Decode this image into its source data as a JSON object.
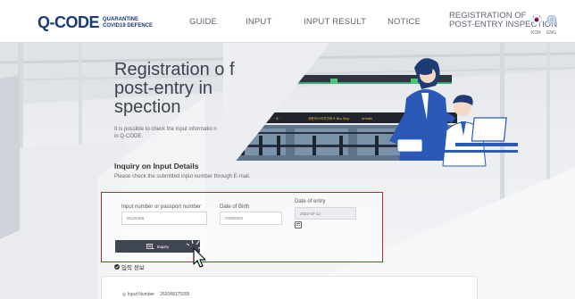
{
  "header": {
    "logo": {
      "main": "Q-CODE",
      "sub_line1": "QUARANTINE",
      "sub_line2": "COVID19 DEFENCE"
    },
    "nav": [
      {
        "label": "GUIDE"
      },
      {
        "label": "INPUT"
      },
      {
        "label": "INPUT RESULT"
      },
      {
        "label": "NOTICE"
      }
    ],
    "registration": {
      "line1": "REGISTRATION OF",
      "line2": "POST-ENTRY INSPECTION"
    },
    "languages": [
      {
        "code": "KOR"
      },
      {
        "code": "ENG"
      }
    ]
  },
  "hero": {
    "title": "Registration o f post-entry in spection",
    "description": "It is possible to check the input informatio n in Q-CODE.",
    "signboard": [
      {
        "text": "현금카드/교통카드 충전(1층) · ·· $ ··"
      },
      {
        "text": "공항버스/리무진버스 Bus Stop"
      },
      {
        "text": "Arrivals"
      }
    ]
  },
  "inquiry": {
    "title": "Inquiry on Input Details",
    "subtitle": "Please check the submitted input number through E-mail.",
    "fields": {
      "input_number": {
        "label": "Input number or passport number",
        "value": "M12S456"
      },
      "birth": {
        "label": "Date of Birth",
        "value": "20060304"
      },
      "entry": {
        "label": "Date of entry",
        "value": "2022-07-12"
      }
    },
    "button_label": "Inquiry"
  },
  "result": {
    "heading": "입력 정보",
    "row_label": "Input Number",
    "row_value": "262048175095"
  },
  "colors": {
    "brand_navy": "#1e3a72",
    "highlight_border": "#c4222a",
    "button_bg": "#404651"
  }
}
